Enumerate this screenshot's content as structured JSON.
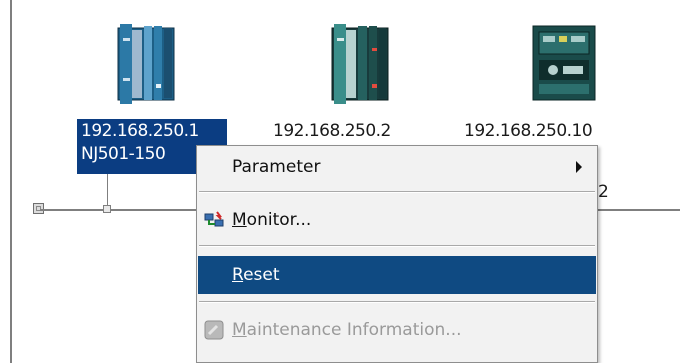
{
  "devices": [
    {
      "ip": "192.168.250.1",
      "model": "NJ501-150",
      "icon": "controller-icon",
      "selected": true
    },
    {
      "ip": "192.168.250.2",
      "icon": "controller-icon"
    },
    {
      "ip": "192.168.250.10",
      "icon": "terminal-icon"
    }
  ],
  "partial_text": "2",
  "context_menu": {
    "items": [
      {
        "label": "Parameter",
        "has_submenu": true
      },
      {
        "label": "Monitor...",
        "mnemonic": "M",
        "rest": "onitor...",
        "icon": "monitor-icon"
      },
      {
        "label": "Reset",
        "mnemonic": "R",
        "rest": "eset",
        "highlighted": true
      },
      {
        "label": "Maintenance Information...",
        "mnemonic": "M",
        "rest": "aintenance Information...",
        "icon": "maintenance-icon",
        "disabled": true
      }
    ]
  },
  "colors": {
    "selection": "#0b3d82",
    "menu_highlight": "#0f4a82",
    "menu_background": "#f2f2f2"
  }
}
